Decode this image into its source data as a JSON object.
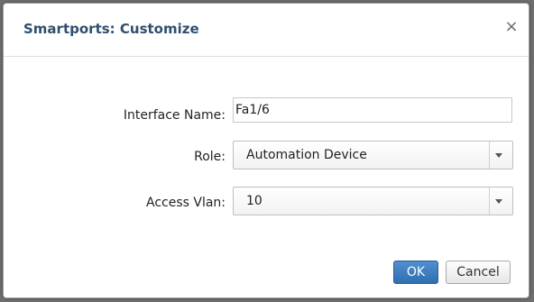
{
  "dialog": {
    "title": "Smartports: Customize",
    "close_glyph": "×",
    "close_icon": "close-icon"
  },
  "form": {
    "interface_name": {
      "label": "Interface Name:",
      "value": "Fa1/6"
    },
    "role": {
      "label": "Role:",
      "selected": "Automation Device"
    },
    "access_vlan": {
      "label": "Access Vlan:",
      "selected": "10"
    }
  },
  "buttons": {
    "ok_label": "OK",
    "cancel_label": "Cancel"
  },
  "colors": {
    "title": "#2f4f6f",
    "primary_button": "#3a7bbf",
    "overlay": "#6e6e6e"
  }
}
